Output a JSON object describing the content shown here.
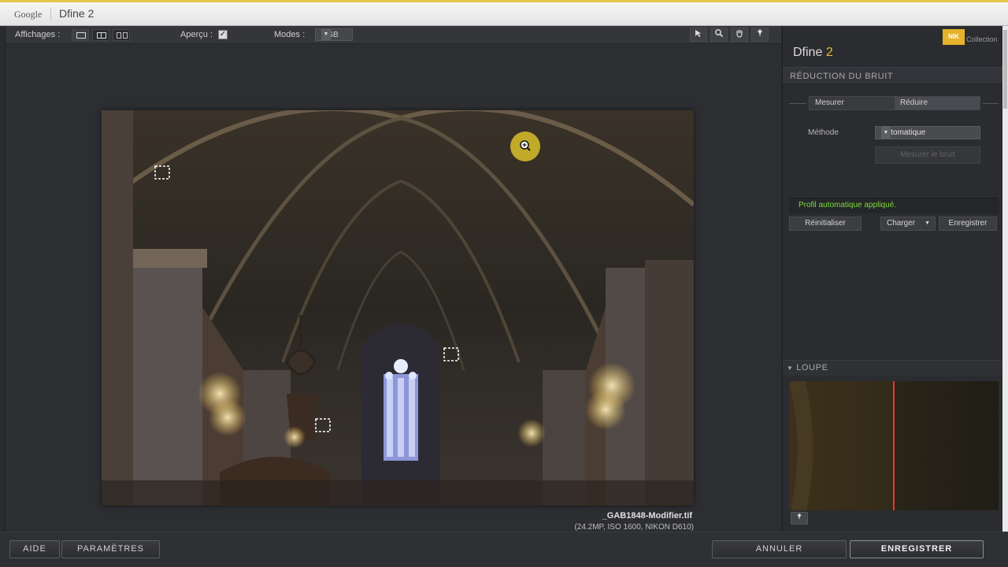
{
  "window": {
    "brand": "Google",
    "title": "Dfine 2"
  },
  "toolbar": {
    "views_label": "Affichages :",
    "preview_label": "Aperçu :",
    "preview_checked": true,
    "modes_label": "Modes :",
    "mode_value": "RGB",
    "tools": [
      "pointer-icon",
      "zoom-icon",
      "hand-icon",
      "pin-icon"
    ]
  },
  "image": {
    "file_name": "_GAB1848-Modifier.tif",
    "file_info": "(24.2MP, ISO 1600, NIKON D610)"
  },
  "panel": {
    "logo": "NIK",
    "logo_sub": "Collection",
    "title_name": "Dfine",
    "title_version": "2",
    "section": "RÉDUCTION DU BRUIT",
    "tabs": [
      "Mesurer",
      "Réduire"
    ],
    "active_tab": "Réduire",
    "method_label": "Méthode",
    "method_value": "Automatique",
    "measure_button": "Mesurer le bruit",
    "status_text": "Profil automatique appliqué.",
    "reset_button": "Réinitialiser",
    "load_button": "Charger",
    "save_button": "Enregistrer",
    "loupe_label": "LOUPE"
  },
  "footer": {
    "help": "AIDE",
    "settings": "PARAMÈTRES",
    "cancel": "ANNULER",
    "save": "ENREGISTRER"
  },
  "colors": {
    "accent": "#e8b82e",
    "status": "#7bdc3a",
    "loupe_split": "#e53935"
  }
}
